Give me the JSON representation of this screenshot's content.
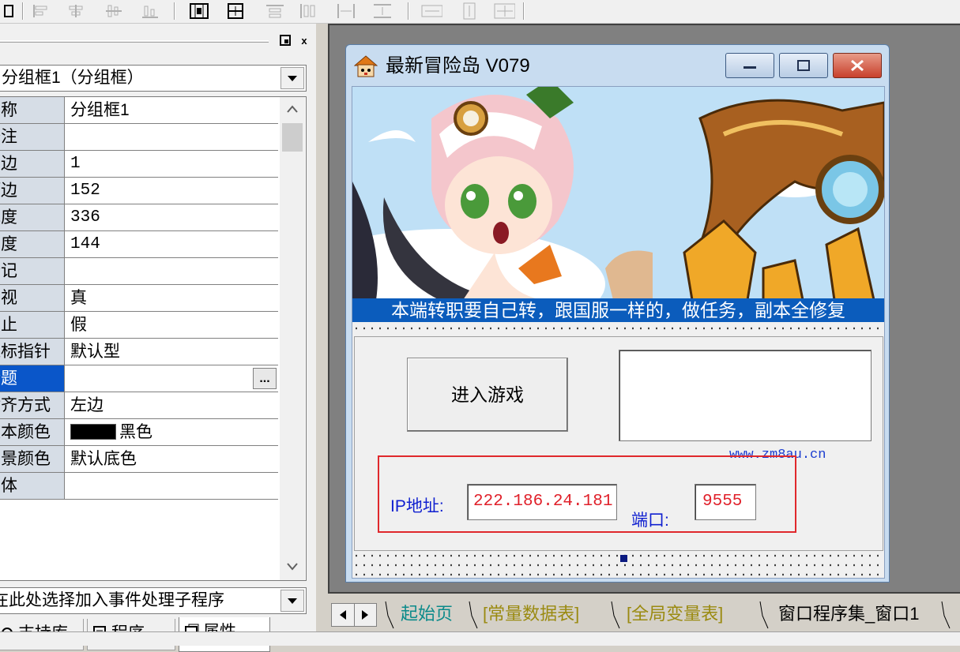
{
  "toolbar": {
    "buttons": [
      "align-left-icon",
      "align-center-h-icon",
      "align-center-v-icon",
      "align-bottom-icon",
      "same-width-icon",
      "same-height-icon",
      "distribute-h-icon",
      "distribute-v-icon",
      "space-h-icon",
      "space-v-icon",
      "center-h-icon",
      "center-v-icon",
      "center-form-icon"
    ]
  },
  "property_panel": {
    "object_selector": "分组框1（分组框）",
    "rows": [
      {
        "name": "名称",
        "value": "分组框1"
      },
      {
        "name": "备注",
        "value": ""
      },
      {
        "name": "左边",
        "value": "1"
      },
      {
        "name": "顶边",
        "value": "152"
      },
      {
        "name": "宽度",
        "value": "336"
      },
      {
        "name": "高度",
        "value": "144"
      },
      {
        "name": "标记",
        "value": ""
      },
      {
        "name": "可视",
        "value": "真"
      },
      {
        "name": "禁止",
        "value": "假"
      },
      {
        "name": "鼠标指针",
        "value": "默认型"
      },
      {
        "name": "标题",
        "value": ""
      },
      {
        "name": "对齐方式",
        "value": "左边"
      },
      {
        "name": "文本颜色",
        "value": "黑色"
      },
      {
        "name": "背景颜色",
        "value": "默认底色"
      },
      {
        "name": "字体",
        "value": ""
      }
    ],
    "ellipsis_label": "...",
    "event_selector": "在此处选择加入事件处理子程序",
    "tabs": [
      "支持库",
      "程序",
      "属性"
    ],
    "active_tab": "属性",
    "close_label": "x"
  },
  "form": {
    "title": "最新冒险岛 V079",
    "banner_caption": "本端转职要自己转，跟国服一样的，做任务，副本全修复",
    "enter_button": "进入游戏",
    "site_url": "www.zm8au.cn",
    "ip_label": "IP地址:",
    "ip_value": "222.186.24.181",
    "port_label": "端口:",
    "port_value": "9555"
  },
  "editor_tabs": [
    "起始页",
    "[常量数据表]",
    "[全局变量表]",
    "窗口程序集_窗口1"
  ],
  "colors": {
    "accent_blue": "#0b5cbc",
    "selected_row": "#0a56c9",
    "input_text": "#e0202a",
    "label_blue": "#1020d0",
    "highlight_rect": "#e0282c",
    "tab_teal": "#0a8a8a",
    "tab_olive": "#9a8a10"
  }
}
